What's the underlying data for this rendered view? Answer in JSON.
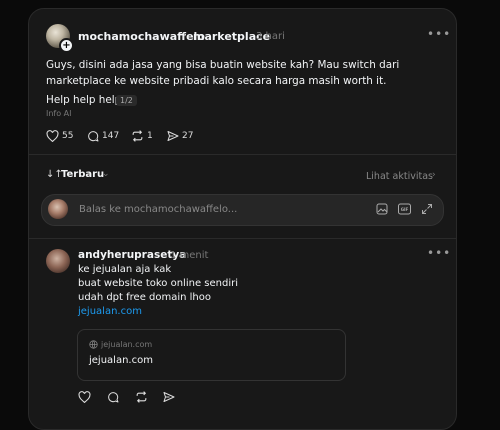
{
  "post": {
    "author": "mochamochawaffelo",
    "community": "marketplace",
    "time": "3 hari",
    "text": "Guys, disini ada jasa yang bisa buatin website kah? Mau switch dari marketplace ke website pribadi kalo secara harga masih worth it.",
    "subtext": "Help help help",
    "page_indicator": "1/2",
    "info": "Info AI",
    "likes": "55",
    "comments": "147",
    "reposts": "1",
    "shares": "27"
  },
  "sort": {
    "label": "Terbaru",
    "activity_link": "Lihat aktivitas"
  },
  "reply_input": {
    "placeholder": "Balas ke mochamochawaffelo..."
  },
  "reply": {
    "author": "andyheruprasetya",
    "time": "1 menit",
    "lines": [
      "ke jejualan aja kak",
      "buat website toko online sendiri",
      "udah dpt free domain lhoo"
    ],
    "link_text": "jejualan.com",
    "preview_domain": "jejualan.com",
    "preview_title": "jejualan.com"
  },
  "colors": {
    "background": "#0a0a0a",
    "card": "#181818",
    "link": "#1d9bf0",
    "muted": "#777777"
  }
}
